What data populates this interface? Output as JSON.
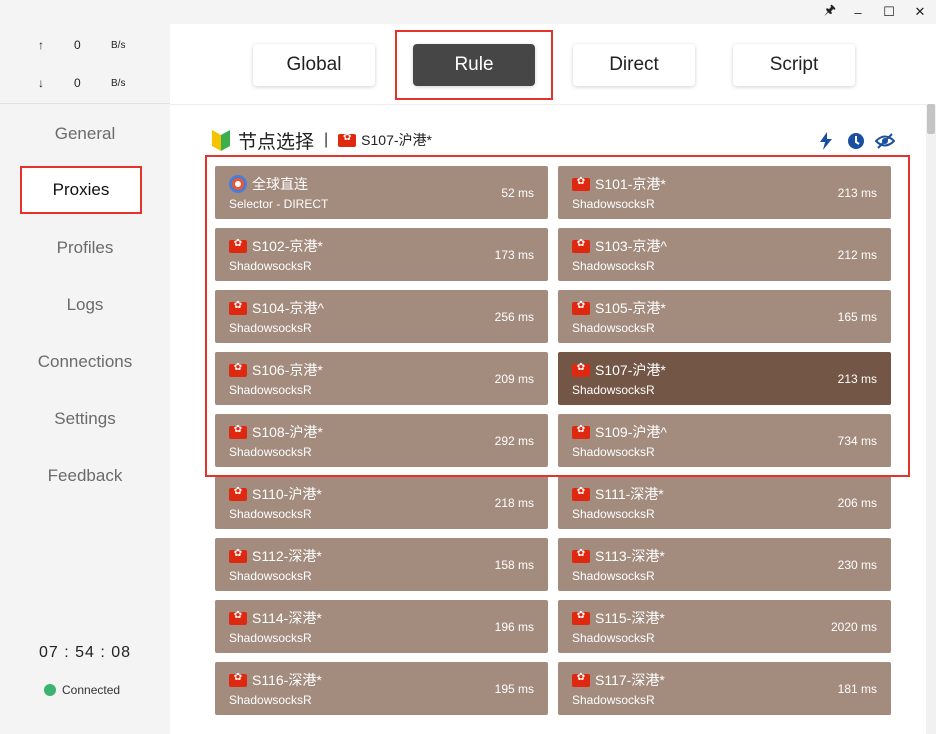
{
  "titlebar": {
    "pin": "🖈",
    "minimize": "–",
    "maximize": "☐",
    "close": "✕"
  },
  "traffic": {
    "up": {
      "arrow": "↑",
      "value": "0",
      "unit": "B/s"
    },
    "down": {
      "arrow": "↓",
      "value": "0",
      "unit": "B/s"
    }
  },
  "nav": [
    {
      "label": "General"
    },
    {
      "label": "Proxies"
    },
    {
      "label": "Profiles"
    },
    {
      "label": "Logs"
    },
    {
      "label": "Connections"
    },
    {
      "label": "Settings"
    },
    {
      "label": "Feedback"
    }
  ],
  "footer": {
    "time": "07 : 54 : 08",
    "status": "Connected"
  },
  "modes": [
    "Global",
    "Rule",
    "Direct",
    "Script"
  ],
  "group": {
    "icon": "beginner-icon",
    "title": "节点选择",
    "separator": "|",
    "selected": "S107-沪港*"
  },
  "proxies": [
    {
      "name": "全球直连",
      "type": "Selector - DIRECT",
      "delay": "52 ms",
      "icon": "globe-icon"
    },
    {
      "name": "S101-京港*",
      "type": "ShadowsocksR",
      "delay": "213 ms"
    },
    {
      "name": "S102-京港*",
      "type": "ShadowsocksR",
      "delay": "173 ms"
    },
    {
      "name": "S103-京港^",
      "type": "ShadowsocksR",
      "delay": "212 ms"
    },
    {
      "name": "S104-京港^",
      "type": "ShadowsocksR",
      "delay": "256 ms"
    },
    {
      "name": "S105-京港*",
      "type": "ShadowsocksR",
      "delay": "165 ms"
    },
    {
      "name": "S106-京港*",
      "type": "ShadowsocksR",
      "delay": "209 ms"
    },
    {
      "name": "S107-沪港*",
      "type": "ShadowsocksR",
      "delay": "213 ms"
    },
    {
      "name": "S108-沪港*",
      "type": "ShadowsocksR",
      "delay": "292 ms"
    },
    {
      "name": "S109-沪港^",
      "type": "ShadowsocksR",
      "delay": "734 ms"
    },
    {
      "name": "S110-沪港*",
      "type": "ShadowsocksR",
      "delay": "218 ms"
    },
    {
      "name": "S111-深港*",
      "type": "ShadowsocksR",
      "delay": "206 ms"
    },
    {
      "name": "S112-深港*",
      "type": "ShadowsocksR",
      "delay": "158 ms"
    },
    {
      "name": "S113-深港*",
      "type": "ShadowsocksR",
      "delay": "230 ms"
    },
    {
      "name": "S114-深港*",
      "type": "ShadowsocksR",
      "delay": "196 ms"
    },
    {
      "name": "S115-深港*",
      "type": "ShadowsocksR",
      "delay": "2020 ms"
    },
    {
      "name": "S116-深港*",
      "type": "ShadowsocksR",
      "delay": "195 ms"
    },
    {
      "name": "S117-深港*",
      "type": "ShadowsocksR",
      "delay": "181 ms"
    }
  ],
  "colors": {
    "card": "#a38b7e",
    "card_selected": "#735645",
    "highlight": "#e5322d",
    "active_mode": "#464646",
    "connected": "#3cb371"
  }
}
